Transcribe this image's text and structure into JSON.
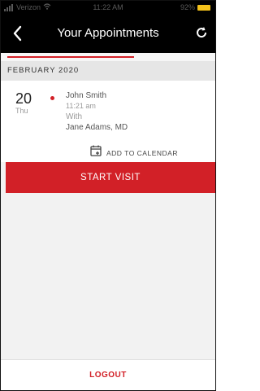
{
  "status_bar": {
    "carrier": "Verizon",
    "time": "11:22 AM",
    "battery": "92%",
    "battery_color": "#f4c21b"
  },
  "navbar": {
    "title": "Your Appointments",
    "back_icon": "back-chevron-icon",
    "refresh_icon": "refresh-icon"
  },
  "month_header": "FEBRUARY 2020",
  "appointment": {
    "day": "20",
    "weekday": "Thu",
    "patient": "John Smith",
    "time": "11:21 am",
    "with_label": "With",
    "provider": "Jane Adams, MD",
    "add_to_calendar_label": "ADD TO CALENDAR"
  },
  "actions": {
    "start_visit": "START VISIT",
    "logout": "LOGOUT"
  },
  "colors": {
    "accent": "#d22027",
    "header_bg": "#000000"
  }
}
